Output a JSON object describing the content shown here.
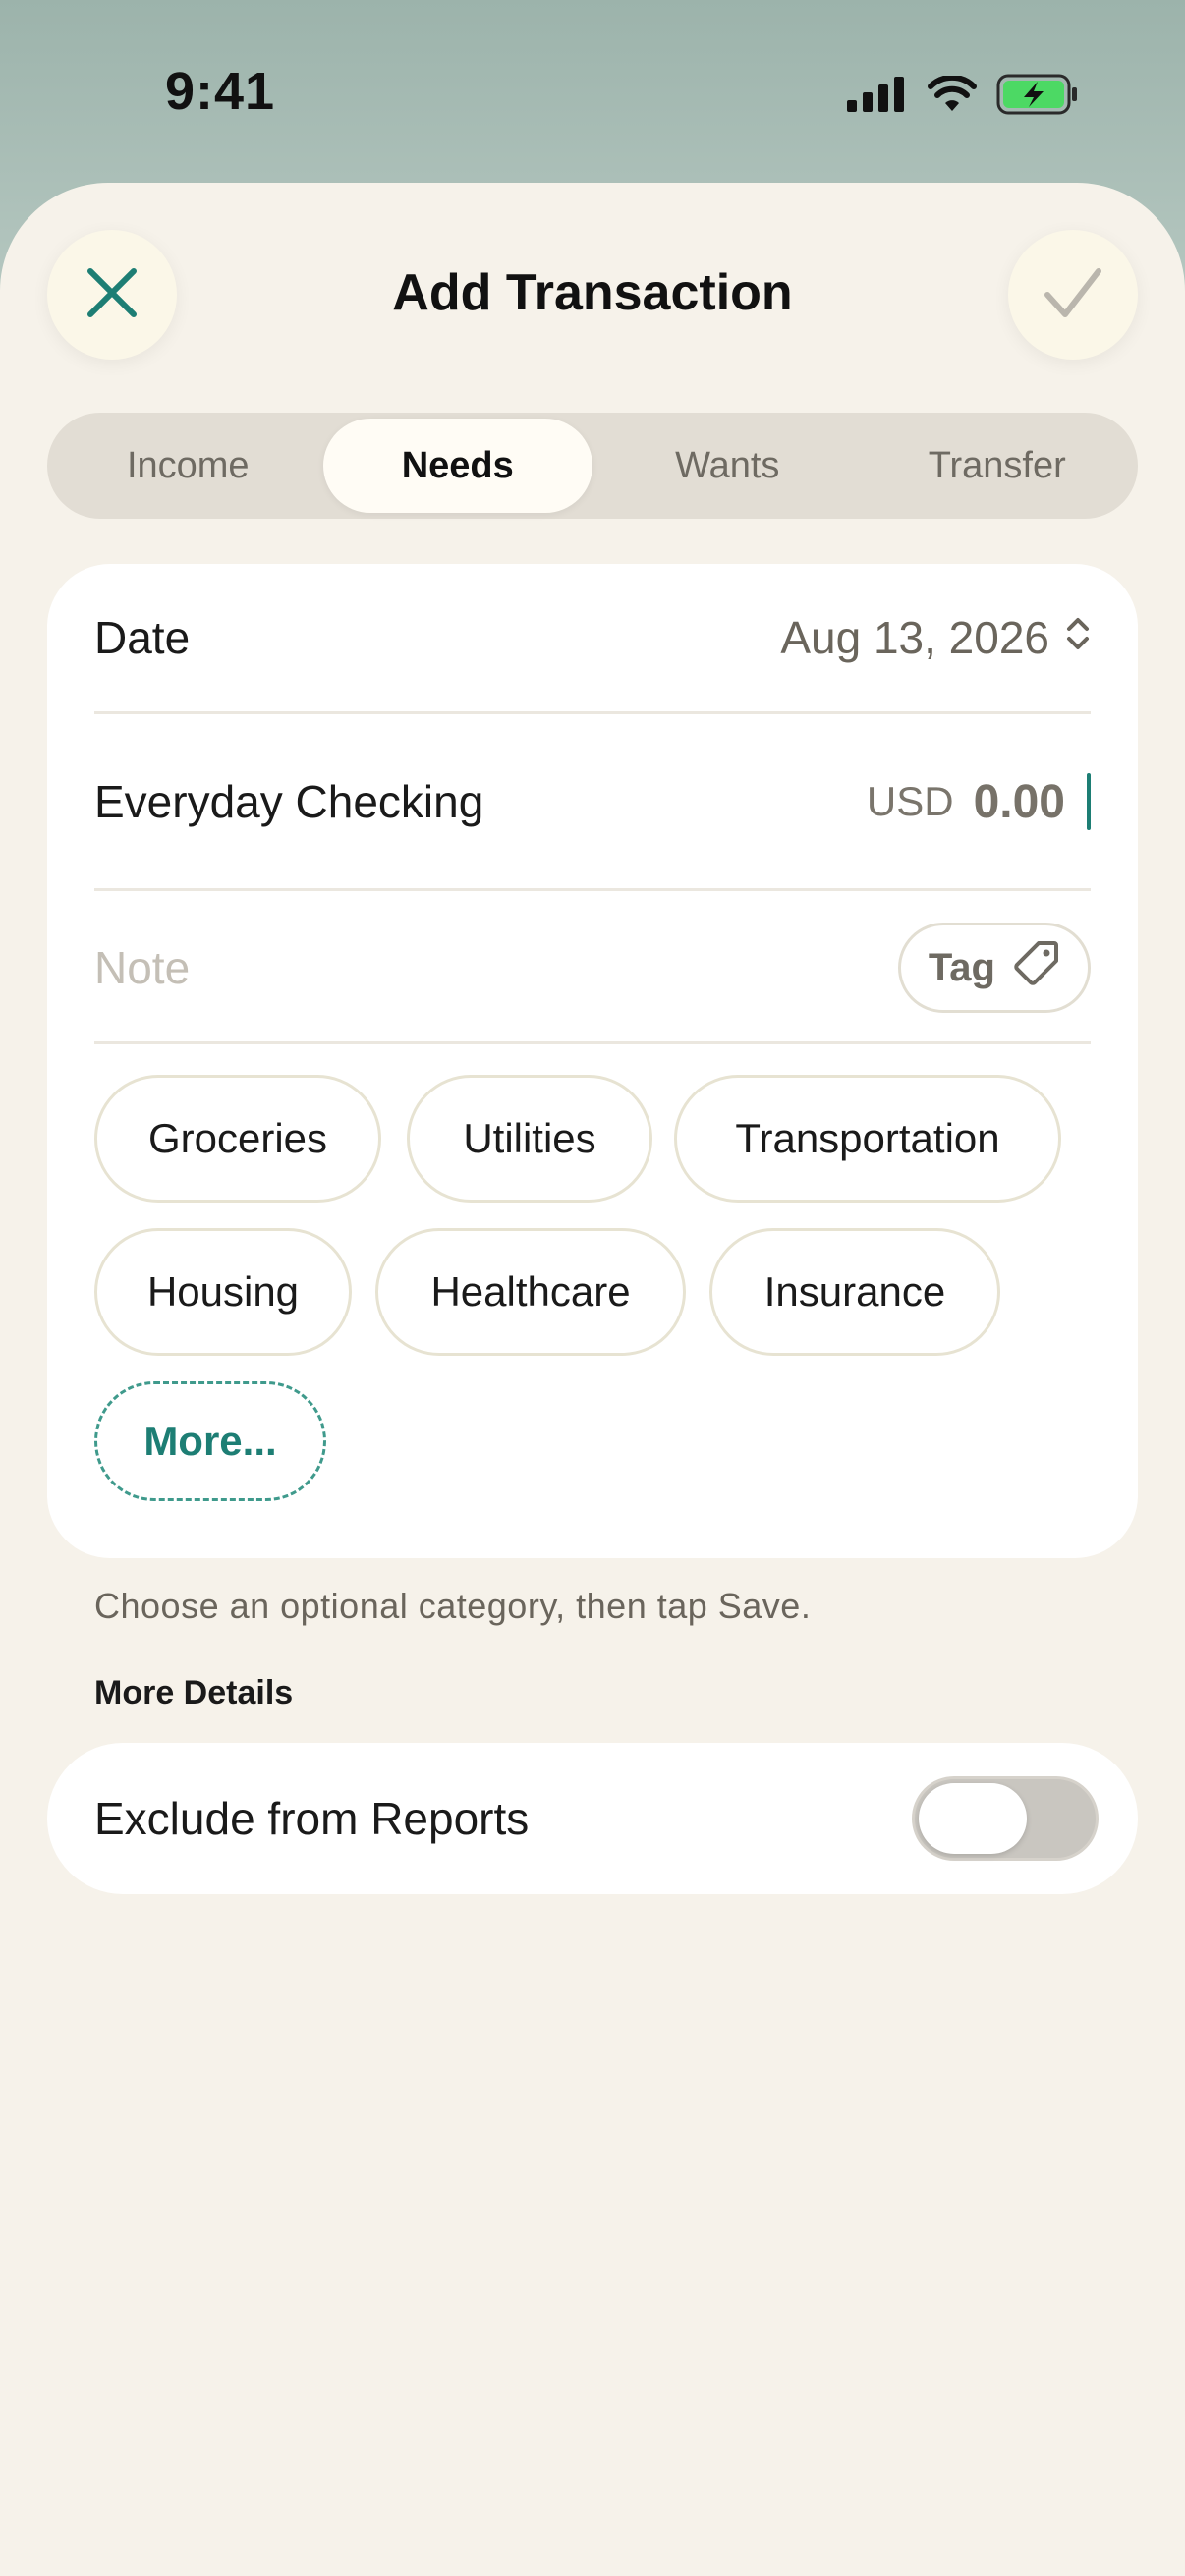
{
  "status_bar": {
    "time": "9:41",
    "icons": [
      "signal-icon",
      "wifi-icon",
      "battery-charging-icon"
    ]
  },
  "header": {
    "title": "Add Transaction",
    "close_icon": "close-icon",
    "save_icon": "checkmark-icon"
  },
  "segments": [
    {
      "label": "Income",
      "selected": false
    },
    {
      "label": "Needs",
      "selected": true
    },
    {
      "label": "Wants",
      "selected": false
    },
    {
      "label": "Transfer",
      "selected": false
    }
  ],
  "form": {
    "date_label": "Date",
    "date_value": "Aug 13, 2026",
    "account_label": "Everyday Checking",
    "currency": "USD",
    "amount": "0.00",
    "note_placeholder": "Note",
    "tag_label": "Tag"
  },
  "categories": [
    "Groceries",
    "Utilities",
    "Transportation",
    "Housing",
    "Healthcare",
    "Insurance"
  ],
  "more_label": "More...",
  "helper_text": "Choose an optional category, then tap Save.",
  "more_details": {
    "title": "More Details",
    "exclude_label": "Exclude from Reports",
    "exclude_enabled": false
  },
  "colors": {
    "accent": "#1d7e74",
    "sheet_bg": "#f6f2ea",
    "battery_green": "#4cd964"
  }
}
